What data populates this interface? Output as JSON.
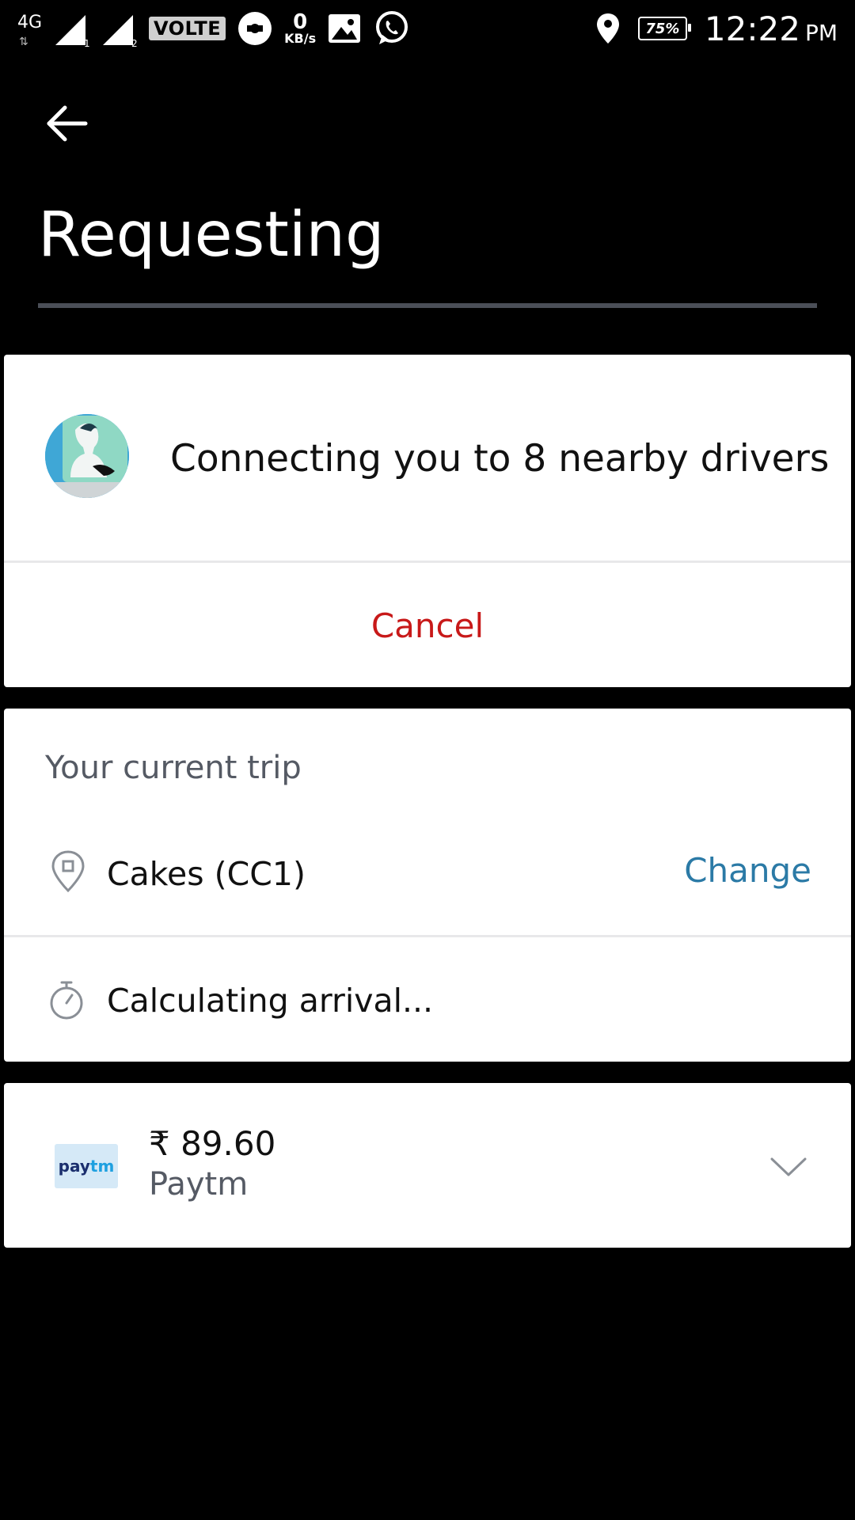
{
  "status_bar": {
    "network_type": "4G",
    "sim1_label": "1",
    "sim2_label": "2",
    "volte": "VOLTE",
    "speed_value": "0",
    "speed_unit": "KB/s",
    "battery": "75%",
    "time": "12:22",
    "ampm": "PM"
  },
  "header": {
    "title": "Requesting"
  },
  "request_card": {
    "message": "Connecting you to 8 nearby drivers",
    "cancel_label": "Cancel",
    "cancel_color": "#c81919"
  },
  "trip_card": {
    "section_label": "Your current trip",
    "destination": "Cakes (CC1)",
    "change_label": "Change",
    "arrival_status": "Calculating arrival...",
    "accent_color": "#2b7aa6"
  },
  "payment_card": {
    "logo_text_pay": "pay",
    "logo_text_tm": "tm",
    "price": "₹ 89.60",
    "method": "Paytm"
  }
}
